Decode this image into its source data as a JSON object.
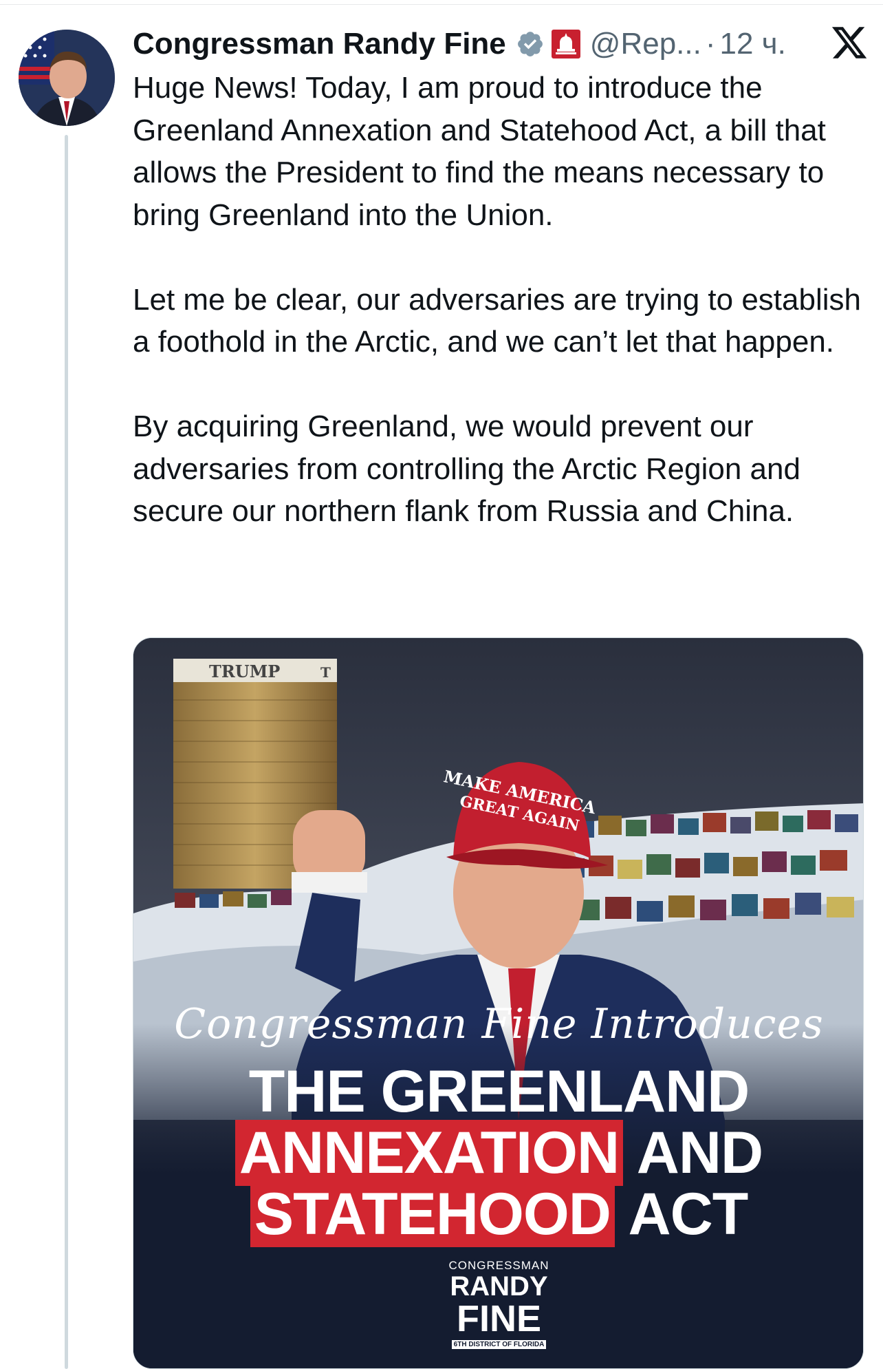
{
  "tweet": {
    "author_name": "Congressman Randy Fine",
    "handle": "@Rep...",
    "separator": "·",
    "timestamp": "12 ч.",
    "paragraphs": [
      "Huge News!  Today, I am proud to introduce the Greenland Annexation and Statehood Act, a bill that allows the President to find the means necessary to bring Greenland into the Union.",
      "Let me be clear, our adversaries are trying to establish a foothold in the Arctic, and we can’t let that happen.",
      "By acquiring Greenland, we would prevent our adversaries from controlling the Arctic Region and secure our northern flank from Russia and China."
    ]
  },
  "media": {
    "building_sign": "TRUMP",
    "building_sign_letter": "T",
    "cap_line1": "MAKE AMERICA",
    "cap_line2": "GREAT AGAIN",
    "script_line": "Congressman Fine Introduces",
    "headline_line1": "THE GREENLAND",
    "headline_line2_highlight": "ANNEXATION",
    "headline_line2_rest": "AND",
    "headline_line3_highlight": "STATEHOOD",
    "headline_line3_rest": "ACT",
    "logo_line1": "CONGRESSMAN",
    "logo_line2": "RANDY",
    "logo_line3": "FINE",
    "logo_line4": "6TH DISTRICT OF FLORIDA"
  },
  "icons": {
    "verified": "verified-badge-icon",
    "affiliation": "gop-capitol-icon",
    "platform": "x-logo-icon"
  },
  "colors": {
    "verified_badge": "#829aab",
    "highlight_red": "#d22630",
    "poster_bg": "#141c30"
  }
}
